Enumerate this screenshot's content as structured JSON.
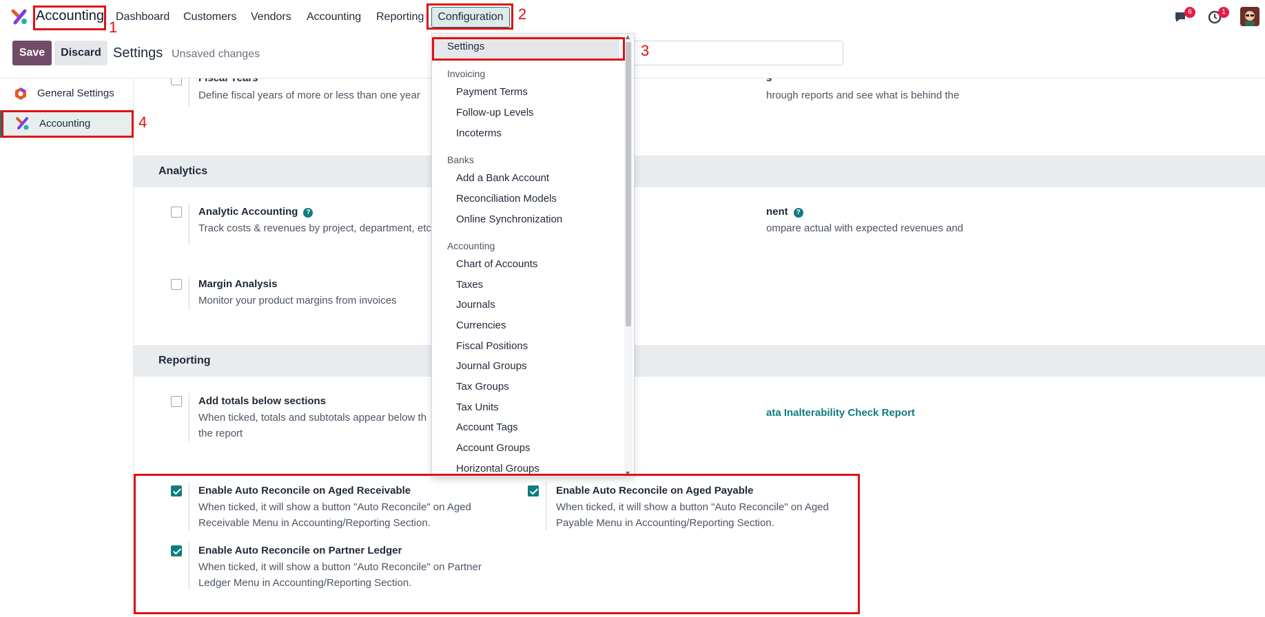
{
  "topbar": {
    "app_name": "Accounting",
    "nav": [
      "Dashboard",
      "Customers",
      "Vendors",
      "Accounting",
      "Reporting"
    ],
    "config_label": "Configuration",
    "messages_badge": "6",
    "activity_badge": "1"
  },
  "controlbar": {
    "save_label": "Save",
    "discard_label": "Discard",
    "title": "Settings",
    "status": "Unsaved changes"
  },
  "sidebar": {
    "items": [
      {
        "label": "General Settings"
      },
      {
        "label": "Accounting"
      }
    ]
  },
  "dropdown": {
    "settings": "Settings",
    "groups": [
      {
        "head": "Invoicing",
        "items": [
          "Payment Terms",
          "Follow-up Levels",
          "Incoterms"
        ]
      },
      {
        "head": "Banks",
        "items": [
          "Add a Bank Account",
          "Reconciliation Models",
          "Online Synchronization"
        ]
      },
      {
        "head": "Accounting",
        "items": [
          "Chart of Accounts",
          "Taxes",
          "Journals",
          "Currencies",
          "Fiscal Positions",
          "Journal Groups",
          "Tax Groups",
          "Tax Units",
          "Account Tags",
          "Account Groups",
          "Horizontal Groups"
        ]
      }
    ]
  },
  "main": {
    "fiscal": {
      "title": "Fiscal Years",
      "desc": "Define fiscal years of more or less than one year",
      "right_title": "s",
      "right_desc": "hrough reports and see what is behind the"
    },
    "analytics": {
      "heading": "Analytics",
      "analytic_title": "Analytic Accounting",
      "analytic_desc": "Track costs & revenues by project, department, etc",
      "budget_title": "nent",
      "budget_desc": "ompare actual with expected revenues and",
      "margin_title": "Margin Analysis",
      "margin_desc": "Monitor your product margins from invoices"
    },
    "reporting": {
      "heading": "Reporting",
      "totals_title": "Add totals below sections",
      "totals_desc1": "When ticked, totals and subtotals appear below th",
      "totals_desc2": "the report",
      "link": "ata Inalterability Check Report",
      "recv_title": "Enable Auto Reconcile on Aged Receivable",
      "recv_desc1": "When ticked, it will show a button \"Auto Reconcile\" on Aged",
      "recv_desc2": "Receivable Menu in Accounting/Reporting Section.",
      "pay_title": "Enable Auto Reconcile on Aged Payable",
      "pay_desc1": "When ticked, it will show a button \"Auto Reconcile\" on Aged",
      "pay_desc2": "Payable Menu in Accounting/Reporting Section.",
      "ledger_title": "Enable Auto Reconcile on Partner Ledger",
      "ledger_desc1": "When ticked, it will show a button \"Auto Reconcile\" on Partner",
      "ledger_desc2": "Ledger Menu in Accounting/Reporting Section."
    }
  },
  "annotations": [
    "1",
    "2",
    "3",
    "4"
  ],
  "colors": {
    "brand": "#714B67",
    "accent": "#0e7c80",
    "annotation": "#e01010"
  }
}
